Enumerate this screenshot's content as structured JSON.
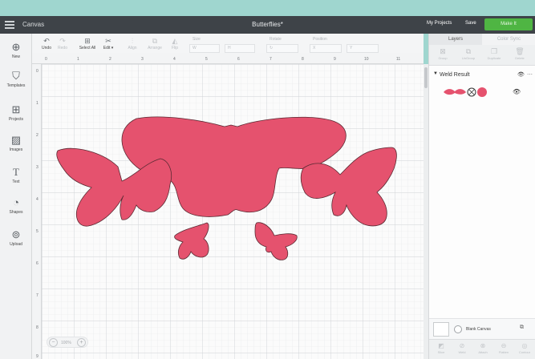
{
  "app": {
    "title": "Canvas",
    "document_title": "Butterflies*"
  },
  "header": {
    "my_projects": "My Projects",
    "save": "Save",
    "make_it": "Make It"
  },
  "toolbar": {
    "undo": "Undo",
    "redo": "Redo",
    "select_all": "Select All",
    "edit": "Edit",
    "align": "Align",
    "arrange": "Arrange",
    "flip": "Flip",
    "size_label": "Size",
    "size_w": "W",
    "size_h": "H",
    "rotate_label": "Rotate",
    "position_label": "Position",
    "pos_x": "X",
    "pos_y": "Y"
  },
  "sidebar": {
    "items": [
      {
        "label": "New",
        "icon": "plus-circle-icon"
      },
      {
        "label": "Templates",
        "icon": "shirt-icon"
      },
      {
        "label": "Projects",
        "icon": "projects-icon"
      },
      {
        "label": "Images",
        "icon": "image-icon"
      },
      {
        "label": "Text",
        "icon": "text-icon"
      },
      {
        "label": "Shapes",
        "icon": "shapes-icon"
      },
      {
        "label": "Upload",
        "icon": "upload-icon"
      }
    ]
  },
  "rulers": {
    "top": [
      "0",
      "1",
      "2",
      "3",
      "4",
      "5",
      "6",
      "7",
      "8",
      "9",
      "10",
      "11"
    ],
    "left": [
      "0",
      "1",
      "2",
      "3",
      "4",
      "5",
      "6",
      "7",
      "8",
      "9"
    ]
  },
  "zoom": {
    "value": "100%",
    "minus": "−",
    "plus": "+"
  },
  "layers_panel": {
    "tabs": [
      "Layers",
      "Color Sync"
    ],
    "tools": [
      "Group",
      "UnGroup",
      "Duplicate",
      "Delete"
    ],
    "group_name": "Weld Result",
    "blank_canvas": "Blank Canvas",
    "bottom_tools": [
      "Slice",
      "Weld",
      "Attach",
      "Flatten",
      "Contour"
    ]
  },
  "colors": {
    "shape_fill": "#e5526e",
    "topbar": "#3e4348",
    "make_button": "#4fb543"
  }
}
